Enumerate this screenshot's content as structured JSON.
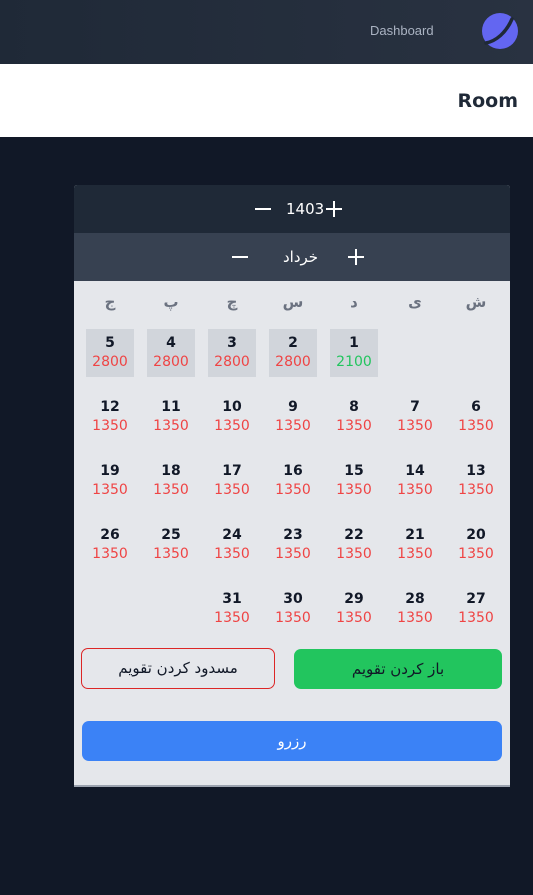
{
  "nav": {
    "dashboard_label": "Dashboard",
    "logo_icon": "moon-logo-icon"
  },
  "header": {
    "title": "Room"
  },
  "calendar": {
    "year": "1403",
    "month": "خرداد",
    "weekdays": [
      "ش",
      "ی",
      "د",
      "س",
      "چ",
      "پ",
      "ج"
    ],
    "weeks": [
      [
        null,
        null,
        {
          "day": "1",
          "price": "2100",
          "booked": true,
          "price_color": "green"
        },
        {
          "day": "2",
          "price": "2800",
          "booked": true
        },
        {
          "day": "3",
          "price": "2800",
          "booked": true
        },
        {
          "day": "4",
          "price": "2800",
          "booked": true
        },
        {
          "day": "5",
          "price": "2800",
          "booked": true
        }
      ],
      [
        {
          "day": "6",
          "price": "1350"
        },
        {
          "day": "7",
          "price": "1350"
        },
        {
          "day": "8",
          "price": "1350"
        },
        {
          "day": "9",
          "price": "1350"
        },
        {
          "day": "10",
          "price": "1350"
        },
        {
          "day": "11",
          "price": "1350"
        },
        {
          "day": "12",
          "price": "1350"
        }
      ],
      [
        {
          "day": "13",
          "price": "1350"
        },
        {
          "day": "14",
          "price": "1350"
        },
        {
          "day": "15",
          "price": "1350"
        },
        {
          "day": "16",
          "price": "1350"
        },
        {
          "day": "17",
          "price": "1350"
        },
        {
          "day": "18",
          "price": "1350"
        },
        {
          "day": "19",
          "price": "1350"
        }
      ],
      [
        {
          "day": "20",
          "price": "1350"
        },
        {
          "day": "21",
          "price": "1350"
        },
        {
          "day": "22",
          "price": "1350"
        },
        {
          "day": "23",
          "price": "1350"
        },
        {
          "day": "24",
          "price": "1350"
        },
        {
          "day": "25",
          "price": "1350"
        },
        {
          "day": "26",
          "price": "1350"
        }
      ],
      [
        {
          "day": "27",
          "price": "1350"
        },
        {
          "day": "28",
          "price": "1350"
        },
        {
          "day": "29",
          "price": "1350"
        },
        {
          "day": "30",
          "price": "1350"
        },
        {
          "day": "31",
          "price": "1350"
        },
        null,
        null
      ]
    ]
  },
  "actions": {
    "block_calendar": "مسدود کردن تقویم",
    "open_calendar": "باز کردن تقویم",
    "reserve": "رزرو"
  },
  "colors": {
    "price_default": "#ef4444",
    "price_green": "#22c55e",
    "booked_bg": "#d1d5db",
    "open_button": "#22c55e",
    "reserve_button": "#3b82f6",
    "block_border": "#dc2626"
  }
}
